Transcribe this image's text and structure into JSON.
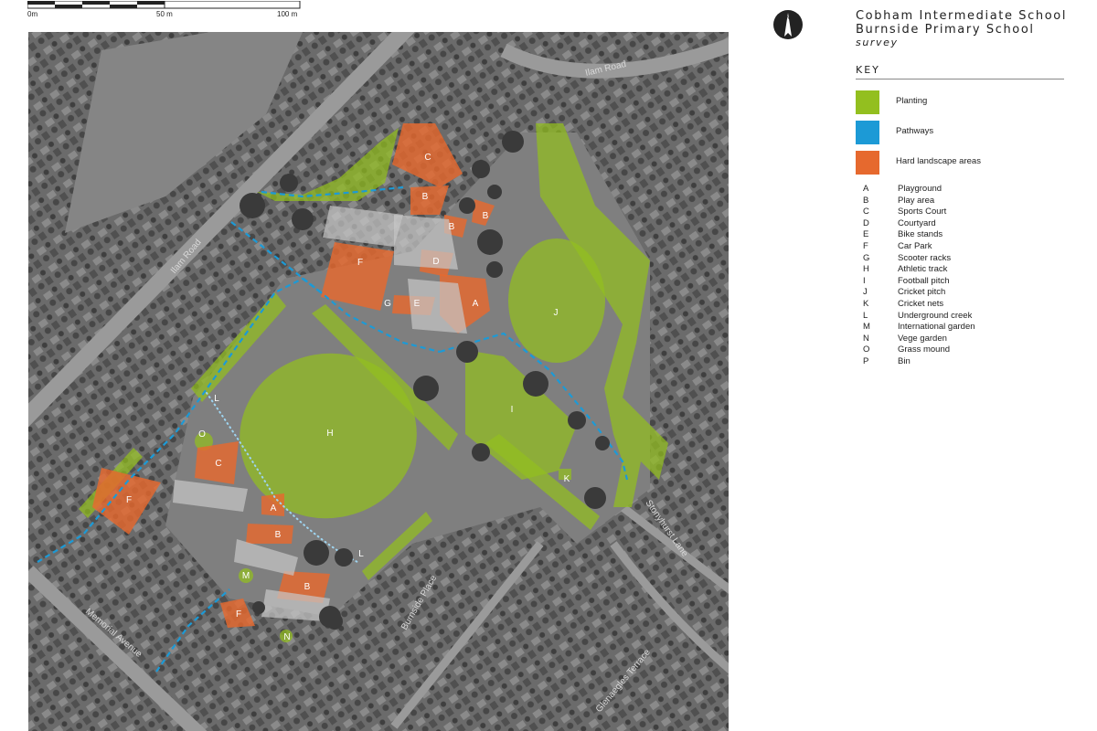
{
  "scale_bar": {
    "labels": [
      "0m",
      "50 m",
      "100 m"
    ]
  },
  "north_arrow": {
    "icon": "north-arrow-icon",
    "letter": "N"
  },
  "title": {
    "line1": "Cobham Intermediate School",
    "line2": "Burnside Primary School",
    "line3": "survey"
  },
  "key": {
    "heading": "KEY",
    "swatches": [
      {
        "label": "Planting",
        "color": "#93bf1f"
      },
      {
        "label": "Pathways",
        "color": "#1c9ad6"
      },
      {
        "label": "Hard landscape areas",
        "color": "#e6692e"
      }
    ],
    "letters": [
      {
        "letter": "A",
        "name": "Playground"
      },
      {
        "letter": "B",
        "name": "Play area"
      },
      {
        "letter": "C",
        "name": "Sports Court"
      },
      {
        "letter": "D",
        "name": "Courtyard"
      },
      {
        "letter": "E",
        "name": "Bike stands"
      },
      {
        "letter": "F",
        "name": "Car Park"
      },
      {
        "letter": "G",
        "name": "Scooter racks"
      },
      {
        "letter": "H",
        "name": "Athletic track"
      },
      {
        "letter": "I",
        "name": "Football pitch"
      },
      {
        "letter": "J",
        "name": "Cricket pitch"
      },
      {
        "letter": "K",
        "name": "Cricket nets"
      },
      {
        "letter": "L",
        "name": "Underground creek"
      },
      {
        "letter": "M",
        "name": "International garden"
      },
      {
        "letter": "N",
        "name": "Vege garden"
      },
      {
        "letter": "O",
        "name": "Grass mound"
      },
      {
        "letter": "P",
        "name": "Bin"
      }
    ]
  },
  "map": {
    "street_labels": [
      "Ilam Road",
      "Ilam Road",
      "Memorial Avenue",
      "Burnside Place",
      "Glenaegles Terrace",
      "Stonyhurst Lane"
    ],
    "site_labels": {
      "C": "C",
      "B": "B",
      "D": "D",
      "F": "F",
      "G": "G",
      "E": "E",
      "A": "A",
      "J": "J",
      "I": "I",
      "H": "H",
      "K": "K",
      "L": "L",
      "O": "O",
      "M": "M",
      "N": "N"
    }
  }
}
